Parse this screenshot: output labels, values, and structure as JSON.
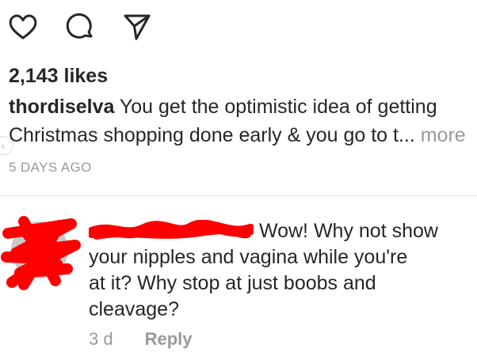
{
  "actions": {
    "like_icon": "heart-icon",
    "comment_icon": "comment-icon",
    "share_icon": "share-icon"
  },
  "post": {
    "likes": "2,143 likes",
    "username": "thordiselva",
    "caption_line1": " You get the optimistic idea of getting",
    "caption_line2": "Christmas shopping done early & you go to t...",
    "more_label": " more",
    "timestamp": "5 DAYS AGO"
  },
  "comment": {
    "text_line1": " Wow! Why not show",
    "text_line2": "your nipples and vagina while you're",
    "text_line3": "at it? Why stop at just boobs and",
    "text_line4": "cleavage?",
    "age": "3 d",
    "reply_label": "Reply"
  },
  "colors": {
    "text": "#262626",
    "muted": "#999999",
    "divider": "#e6e6e6",
    "redaction": "#ff0000"
  }
}
